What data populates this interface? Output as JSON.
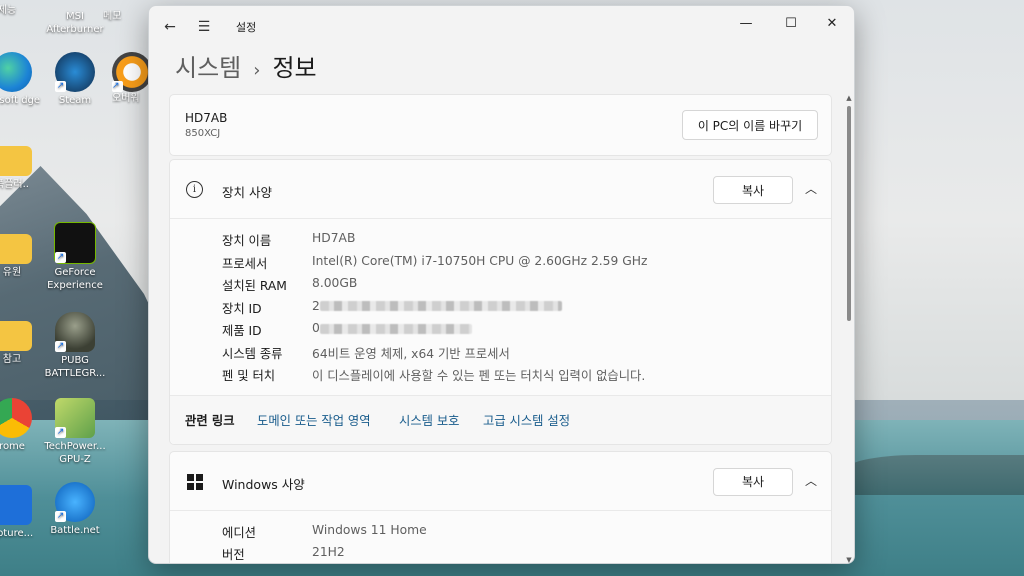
{
  "desktop": {
    "icons": [
      {
        "label": "제능",
        "col": 0
      },
      {
        "label": "MSI Afterburner"
      },
      {
        "label": "메모"
      },
      {
        "label": "crosoft dge"
      },
      {
        "label": "Steam"
      },
      {
        "label": "오버워"
      },
      {
        "label": "폭플러.."
      },
      {
        "label": "GeForce Experience"
      },
      {
        "label": "유원"
      },
      {
        "label": "참고"
      },
      {
        "label": "PUBG BATTLEGR..."
      },
      {
        "label": "rome"
      },
      {
        "label": "TechPower... GPU-Z"
      },
      {
        "label": "apture..."
      },
      {
        "label": "Battle.net"
      }
    ]
  },
  "window": {
    "app_name": "설정",
    "breadcrumb_parent": "시스템",
    "breadcrumb_sep": "›",
    "page_title": "정보",
    "controls": {
      "minimize": "—",
      "maximize": "☐",
      "close": "✕"
    }
  },
  "pc": {
    "name": "HD7AB",
    "model": "850XCJ",
    "rename_button": "이 PC의 이름 바꾸기"
  },
  "device_spec": {
    "title": "장치 사양",
    "copy_button": "복사",
    "rows": [
      {
        "key": "장치 이름",
        "value": "HD7AB"
      },
      {
        "key": "프로세서",
        "value": "Intel(R) Core(TM) i7-10750H CPU @ 2.60GHz   2.59 GHz"
      },
      {
        "key": "설치된 RAM",
        "value": "8.00GB"
      },
      {
        "key": "장치 ID",
        "value": "2"
      },
      {
        "key": "제품 ID",
        "value": "0"
      },
      {
        "key": "시스템 종류",
        "value": "64비트 운영 체제, x64 기반 프로세서"
      },
      {
        "key": "펜 및 터치",
        "value": "이 디스플레이에 사용할 수 있는 펜 또는 터치식 입력이 없습니다."
      }
    ],
    "related_label": "관련 링크",
    "related_links": [
      "도메인 또는 작업 영역",
      "시스템 보호",
      "고급 시스템 설정"
    ]
  },
  "windows_spec": {
    "title": "Windows 사양",
    "copy_button": "복사",
    "rows": [
      {
        "key": "에디션",
        "value": "Windows 11 Home"
      },
      {
        "key": "버전",
        "value": "21H2"
      }
    ]
  }
}
